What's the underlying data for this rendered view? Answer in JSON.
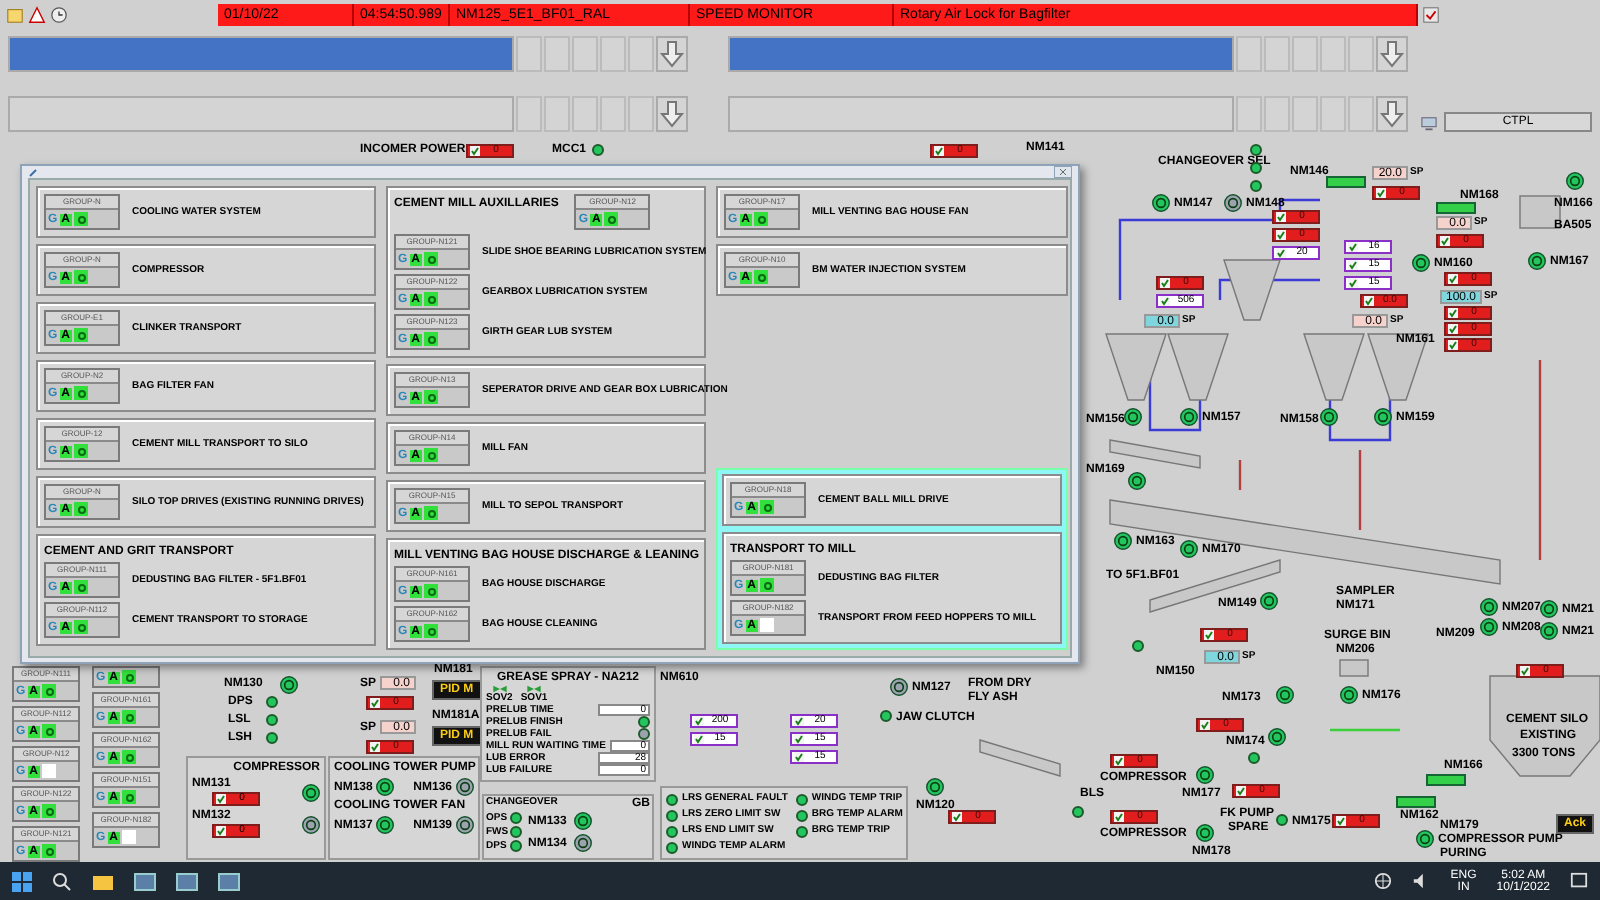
{
  "alarm_bar": {
    "cells": [
      "01/10/22",
      "04:54:50.989",
      "NM125_5E1_BF01_RAL",
      "SPEED MONITOR",
      "Rotary Air Lock for Bagfilter"
    ]
  },
  "alarm_panes": [
    {
      "selected": true
    },
    {
      "selected": true
    },
    {
      "selected": false
    },
    {
      "selected": false
    }
  ],
  "station_field": "CTPL",
  "dialog": {
    "columns": [
      {
        "boxes": [
          {
            "groups": [
              {
                "tag": "GROUP-N",
                "label": "COOLING WATER SYSTEM",
                "mode": "G",
                "auto": "A",
                "on": true
              }
            ]
          },
          {
            "groups": [
              {
                "tag": "GROUP-N",
                "label": "COMPRESSOR",
                "mode": "G",
                "auto": "A",
                "on": true
              }
            ]
          },
          {
            "groups": [
              {
                "tag": "GROUP-E1",
                "label": "CLINKER TRANSPORT",
                "mode": "G",
                "auto": "A",
                "on": true
              }
            ]
          },
          {
            "groups": [
              {
                "tag": "GROUP-N2",
                "label": "BAG FILTER FAN",
                "mode": "G",
                "auto": "A",
                "on": true
              }
            ]
          },
          {
            "groups": [
              {
                "tag": "GROUP-12",
                "label": "CEMENT MILL TRANSPORT TO SILO",
                "mode": "G",
                "auto": "A",
                "on": true
              }
            ]
          },
          {
            "groups": [
              {
                "tag": "GROUP-N",
                "label": "SILO TOP DRIVES (EXISTING RUNNING DRIVES)",
                "mode": "G",
                "auto": "A",
                "on": true
              }
            ]
          },
          {
            "title": "CEMENT AND GRIT TRANSPORT",
            "groups": [
              {
                "tag": "GROUP-N111",
                "label": "DEDUSTING BAG FILTER - 5F1.BF01",
                "mode": "G",
                "auto": "A",
                "on": true
              },
              {
                "tag": "GROUP-N112",
                "label": "CEMENT TRANSPORT TO STORAGE",
                "mode": "G",
                "auto": "A",
                "on": true
              }
            ]
          }
        ]
      },
      {
        "boxes": [
          {
            "title": "CEMENT MILL AUXILLARIES",
            "header_group": {
              "tag": "GROUP-N12",
              "mode": "G",
              "auto": "A",
              "on": true
            },
            "groups": [
              {
                "tag": "GROUP-N121",
                "label": "SLIDE SHOE BEARING LUBRICATION SYSTEM",
                "mode": "G",
                "auto": "A",
                "on": true
              },
              {
                "tag": "GROUP-N122",
                "label": "GEARBOX LUBRICATION SYSTEM",
                "mode": "G",
                "auto": "A",
                "on": true
              },
              {
                "tag": "GROUP-N123",
                "label": "GIRTH GEAR LUB SYSTEM",
                "mode": "G",
                "auto": "A",
                "on": true
              }
            ]
          },
          {
            "groups": [
              {
                "tag": "GROUP-N13",
                "label": "SEPERATOR DRIVE AND GEAR BOX LUBRICATION",
                "mode": "G",
                "auto": "A",
                "on": true
              }
            ]
          },
          {
            "groups": [
              {
                "tag": "GROUP-N14",
                "label": "MILL FAN",
                "mode": "G",
                "auto": "A",
                "on": true
              }
            ]
          },
          {
            "groups": [
              {
                "tag": "GROUP-N15",
                "label": "MILL TO SEPOL TRANSPORT",
                "mode": "G",
                "auto": "A",
                "on": true
              }
            ]
          },
          {
            "title": "MILL VENTING BAG HOUSE DISCHARGE & LEANING",
            "groups": [
              {
                "tag": "GROUP-N161",
                "label": "BAG HOUSE DISCHARGE",
                "mode": "G",
                "auto": "A",
                "on": true
              },
              {
                "tag": "GROUP-N162",
                "label": "BAG HOUSE CLEANING",
                "mode": "G",
                "auto": "A",
                "on": true
              }
            ]
          }
        ]
      },
      {
        "boxes": [
          {
            "groups": [
              {
                "tag": "GROUP-N17",
                "label": "MILL VENTING BAG HOUSE FAN",
                "mode": "G",
                "auto": "A",
                "on": true
              }
            ]
          },
          {
            "groups": [
              {
                "tag": "GROUP-N10",
                "label": "BM WATER INJECTION SYSTEM",
                "mode": "G",
                "auto": "A",
                "on": true
              }
            ]
          }
        ],
        "panel": {
          "highlighted": true,
          "boxes": [
            {
              "groups": [
                {
                  "tag": "GROUP-N18",
                  "label": "CEMENT BALL MILL DRIVE",
                  "mode": "G",
                  "auto": "A",
                  "on": true
                }
              ]
            },
            {
              "title": "TRANSPORT TO MILL",
              "groups": [
                {
                  "tag": "GROUP-N181",
                  "label": "DEDUSTING BAG FILTER",
                  "mode": "G",
                  "auto": "A",
                  "on": true
                },
                {
                  "tag": "GROUP-N182",
                  "label": "TRANSPORT FROM FEED HOPPERS TO MILL",
                  "mode": "G",
                  "auto": "A",
                  "on": false
                }
              ]
            }
          ]
        }
      }
    ]
  },
  "background_groups": [
    [
      {
        "tag": "GROUP-N111",
        "mode": "G",
        "auto": "A",
        "on": true
      },
      {
        "tag": "GROUP-N112",
        "mode": "G",
        "auto": "A",
        "on": true
      },
      {
        "tag": "GROUP-N12",
        "mode": "G",
        "auto": "A",
        "on": false
      },
      {
        "tag": "GROUP-N122",
        "mode": "G",
        "auto": "A",
        "on": true
      },
      {
        "tag": "GROUP-N121",
        "mode": "G",
        "auto": "A",
        "on": true
      }
    ],
    [
      {
        "mode": "G",
        "auto": "A",
        "on": true
      },
      {
        "tag": "GROUP-N161",
        "mode": "G",
        "auto": "A",
        "on": true
      },
      {
        "tag": "GROUP-N162",
        "mode": "G",
        "auto": "A",
        "on": true
      },
      {
        "tag": "GROUP-N151",
        "mode": "G",
        "auto": "A",
        "on": true
      },
      {
        "tag": "GROUP-N182",
        "mode": "G",
        "auto": "A",
        "on": false
      }
    ]
  ],
  "plant": [
    {
      "kind": "text",
      "text": "INCOMER POWER"
    },
    {
      "kind": "value",
      "value": "0",
      "alarm": true
    },
    {
      "kind": "text",
      "text": "MCC1"
    },
    {
      "kind": "lamp",
      "on": true
    },
    {
      "kind": "value",
      "value": "0",
      "alarm": true
    },
    {
      "kind": "text",
      "text": "NM141"
    },
    {
      "kind": "text",
      "text": "CHANGEOVER SEL"
    },
    {
      "kind": "lamp",
      "on": true
    },
    {
      "kind": "lamp",
      "on": true
    },
    {
      "kind": "lamp",
      "on": true
    },
    {
      "kind": "text",
      "text": "NM146"
    },
    {
      "kind": "bar"
    },
    {
      "kind": "setpoint",
      "value": "20.0",
      "label": "SP",
      "color": "#f6d2cc"
    },
    {
      "kind": "value",
      "value": "0",
      "alarm": true
    },
    {
      "kind": "text",
      "text": "NM168"
    },
    {
      "kind": "bar"
    },
    {
      "kind": "motor",
      "label": "NM147",
      "on": true
    },
    {
      "kind": "motor",
      "label": "NM148",
      "on": false
    },
    {
      "kind": "value",
      "value": "0",
      "alarm": true
    },
    {
      "kind": "value",
      "value": "0",
      "alarm": true
    },
    {
      "kind": "value",
      "value": "20",
      "alarm": false
    },
    {
      "kind": "value",
      "value": "0",
      "alarm": true
    },
    {
      "kind": "value",
      "value": "506",
      "alarm": false
    },
    {
      "kind": "setpoint",
      "value": "0.0",
      "label": "SP",
      "color": "#7fd6dc"
    },
    {
      "kind": "value",
      "value": "16",
      "alarm": false
    },
    {
      "kind": "value",
      "value": "15",
      "alarm": false
    },
    {
      "kind": "value",
      "value": "15",
      "alarm": false
    },
    {
      "kind": "value",
      "value": "0.0",
      "alarm": true
    },
    {
      "kind": "setpoint",
      "value": "0.0",
      "label": "SP",
      "color": "#f6d2cc"
    },
    {
      "kind": "setpoint",
      "value": "0.0",
      "label": "SP",
      "color": "#f6d2cc"
    },
    {
      "kind": "value",
      "value": "0",
      "alarm": true
    },
    {
      "kind": "motor",
      "label": "NM160",
      "on": true
    },
    {
      "kind": "value",
      "value": "0",
      "alarm": true
    },
    {
      "kind": "setpoint",
      "value": "100.0",
      "label": "SP",
      "color": "#7fd6dc"
    },
    {
      "kind": "value",
      "value": "0",
      "alarm": true
    },
    {
      "kind": "value",
      "value": "0",
      "alarm": true
    },
    {
      "kind": "value",
      "value": "0",
      "alarm": true
    },
    {
      "kind": "text",
      "text": "NM161"
    },
    {
      "kind": "motor",
      "on": true
    },
    {
      "kind": "text",
      "text": "NM166"
    },
    {
      "kind": "text",
      "text": "BA505"
    },
    {
      "kind": "motor",
      "label": "NM167",
      "on": true
    },
    {
      "kind": "text",
      "text": "NM156"
    },
    {
      "kind": "motor",
      "on": true
    },
    {
      "kind": "motor",
      "label": "NM157",
      "on": true
    },
    {
      "kind": "text",
      "text": "NM158"
    },
    {
      "kind": "motor",
      "on": true
    },
    {
      "kind": "motor",
      "label": "NM159",
      "on": true
    },
    {
      "kind": "text",
      "text": "NM169"
    },
    {
      "kind": "motor",
      "on": true
    },
    {
      "kind": "motor",
      "label": "NM163",
      "on": true
    },
    {
      "kind": "motor",
      "label": "NM170",
      "on": true
    },
    {
      "kind": "text",
      "text": "TO 5F1.BF01"
    },
    {
      "kind": "text",
      "text": "NM149"
    },
    {
      "kind": "motor",
      "on": true
    },
    {
      "kind": "lamp",
      "on": true
    },
    {
      "kind": "value",
      "value": "0",
      "alarm": true
    },
    {
      "kind": "setpoint",
      "value": "0.0",
      "label": "SP",
      "color": "#7fd6dc"
    },
    {
      "kind": "text",
      "text": "NM150"
    },
    {
      "kind": "text",
      "text": "SAMPLER"
    },
    {
      "kind": "text",
      "text": "NM171"
    },
    {
      "kind": "text",
      "text": "SURGE BIN"
    },
    {
      "kind": "text",
      "text": "NM206"
    },
    {
      "kind": "text",
      "text": "NM209"
    },
    {
      "kind": "motor",
      "label": "NM207",
      "on": true
    },
    {
      "kind": "motor",
      "label": "NM208",
      "on": true
    },
    {
      "kind": "motor",
      "label": "NM21",
      "on": true
    },
    {
      "kind": "motor",
      "label": "NM21",
      "on": true
    },
    {
      "kind": "value",
      "value": "0",
      "alarm": true
    },
    {
      "kind": "text",
      "text": "FROM DRY"
    },
    {
      "kind": "text",
      "text": "FLY ASH"
    },
    {
      "kind": "text",
      "text": "NM173"
    },
    {
      "kind": "motor",
      "on": true
    },
    {
      "kind": "motor",
      "label": "NM176",
      "on": true
    },
    {
      "kind": "value",
      "value": "0",
      "alarm": true
    },
    {
      "kind": "text",
      "text": "NM174"
    },
    {
      "kind": "motor",
      "on": true
    },
    {
      "kind": "lamp",
      "on": true
    },
    {
      "kind": "value",
      "value": "0",
      "alarm": true
    },
    {
      "kind": "text",
      "text": "COMPRESSOR"
    },
    {
      "kind": "motor",
      "on": true
    },
    {
      "kind": "text",
      "text": "NM177"
    },
    {
      "kind": "value",
      "value": "0",
      "alarm": true
    },
    {
      "kind": "motor",
      "on": true
    },
    {
      "kind": "text",
      "text": "NM120"
    },
    {
      "kind": "value",
      "value": "0",
      "alarm": true
    },
    {
      "kind": "text",
      "text": "BLS"
    },
    {
      "kind": "lamp",
      "on": true
    },
    {
      "kind": "value",
      "value": "0",
      "alarm": true
    },
    {
      "kind": "text",
      "text": "COMPRESSOR"
    },
    {
      "kind": "motor",
      "on": true
    },
    {
      "kind": "text",
      "text": "NM178"
    },
    {
      "kind": "text",
      "text": "FK PUMP"
    },
    {
      "kind": "text",
      "text": "SPARE"
    },
    {
      "kind": "lamp",
      "on": true
    },
    {
      "kind": "text",
      "text": "NM175"
    },
    {
      "kind": "value",
      "value": "0",
      "alarm": true
    },
    {
      "kind": "text",
      "text": "NM166"
    },
    {
      "kind": "bar"
    },
    {
      "kind": "bar"
    },
    {
      "kind": "text",
      "text": "NM162"
    },
    {
      "kind": "text",
      "text": "NM179"
    },
    {
      "kind": "motor",
      "label": "COMPRESSOR PUMP",
      "on": true
    },
    {
      "kind": "text",
      "text": "PURING"
    },
    {
      "kind": "text",
      "text": "CEMENT SILO"
    },
    {
      "kind": "text",
      "text": "EXISTING"
    },
    {
      "kind": "text",
      "text": "3300 TONS"
    },
    {
      "kind": "button",
      "text": "Ack"
    },
    {
      "kind": "text",
      "text": "NM130"
    },
    {
      "kind": "motor",
      "on": true
    },
    {
      "kind": "text",
      "text": "DPS"
    },
    {
      "kind": "lamp",
      "on": true
    },
    {
      "kind": "text",
      "text": "LSL"
    },
    {
      "kind": "lamp",
      "on": true
    },
    {
      "kind": "text",
      "text": "LSH"
    },
    {
      "kind": "lamp",
      "on": true
    },
    {
      "kind": "text",
      "text": "SP"
    },
    {
      "kind": "setpoint",
      "value": "0.0",
      "color": "#f6d2cc"
    },
    {
      "kind": "value",
      "value": "0",
      "alarm": true
    },
    {
      "kind": "text",
      "text": "SP"
    },
    {
      "kind": "setpoint",
      "value": "0.0",
      "color": "#f6d2cc"
    },
    {
      "kind": "value",
      "value": "0",
      "alarm": true
    },
    {
      "kind": "text",
      "text": "NM181"
    },
    {
      "kind": "button",
      "text": "PID M"
    },
    {
      "kind": "text",
      "text": "NM181A"
    },
    {
      "kind": "button",
      "text": "PID M"
    },
    {
      "kind": "text",
      "text": "NM610"
    },
    {
      "kind": "motor",
      "label": "NM127",
      "on": false
    },
    {
      "kind": "value",
      "value": "200",
      "alarm": false
    },
    {
      "kind": "value",
      "value": "20",
      "alarm": false
    },
    {
      "kind": "lamp",
      "on": true
    },
    {
      "kind": "text",
      "text": "JAW CLUTCH"
    },
    {
      "kind": "value",
      "value": "15",
      "alarm": false
    },
    {
      "kind": "value",
      "value": "15",
      "alarm": false
    },
    {
      "kind": "value",
      "value": "15",
      "alarm": false
    }
  ],
  "grease_panel": {
    "title": "GREASE SPRAY - NA212",
    "valves": [
      "SOV2",
      "SOV1"
    ],
    "rows": [
      {
        "kind": "field",
        "label": "PRELUB TIME",
        "value": "0"
      },
      {
        "kind": "lamp",
        "label": "PRELUB FINISH",
        "on": true
      },
      {
        "kind": "lamp",
        "label": "PRELUB FAIL",
        "on": false
      },
      {
        "kind": "field",
        "label": "MILL RUN WAITING TIME",
        "value": "0"
      },
      {
        "kind": "field",
        "label": "LUB ERROR",
        "value": "28"
      },
      {
        "kind": "field",
        "label": "LUB FAILURE",
        "value": "0"
      }
    ]
  },
  "compressor_panel": {
    "title": "COMPRESSOR",
    "motors": [
      {
        "label": "NM131",
        "on": true,
        "value": "0"
      },
      {
        "label": "NM132",
        "on": false,
        "value": "0"
      }
    ]
  },
  "cooling_panel": {
    "sections": [
      {
        "title": "COOLING TOWER PUMP",
        "motors": [
          {
            "label": "NM138",
            "on": true
          },
          {
            "label": "NM136",
            "on": false
          }
        ]
      },
      {
        "title": "COOLING TOWER FAN",
        "motors": [
          {
            "label": "NM137",
            "on": true
          },
          {
            "label": "NM139",
            "on": false
          }
        ]
      }
    ]
  },
  "changeover_panel": {
    "title": "CHANGEOVER",
    "gb": "GB",
    "lamps": [
      {
        "label": "OPS",
        "on": true
      },
      {
        "label": "FWS",
        "on": true
      },
      {
        "label": "DPS",
        "on": true
      }
    ],
    "motors": [
      {
        "label": "NM133",
        "on": true
      },
      {
        "label": "NM134",
        "on": false
      }
    ]
  },
  "fault_panel": {
    "items": [
      {
        "label": "LRS GENERAL FAULT",
        "on": true
      },
      {
        "label": "LRS ZERO LIMIT SW",
        "on": true
      },
      {
        "label": "LRS END LIMIT SW",
        "on": true
      },
      {
        "label": "WINDG TEMP ALARM",
        "on": true
      },
      {
        "label": "WINDG TEMP TRIP",
        "on": true
      },
      {
        "label": "BRG TEMP ALARM",
        "on": true
      },
      {
        "label": "BRG TEMP TRIP",
        "on": true
      }
    ]
  },
  "taskbar": {
    "language": "ENG",
    "region": "IN",
    "time": "5:02 AM",
    "date": "10/1/2022"
  }
}
